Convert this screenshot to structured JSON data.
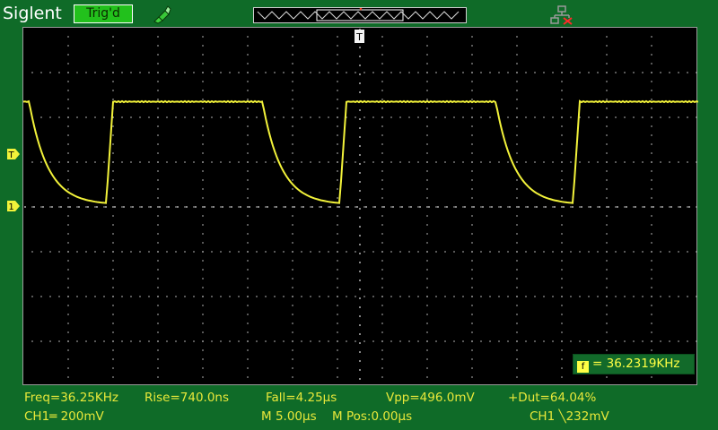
{
  "header": {
    "brand": "Siglent",
    "trigger_status": "Trig'd",
    "probe_icon": "probe-icon",
    "network_icon": "network-disconnected-icon"
  },
  "waveform": {
    "channel": "CH1",
    "color": "#f2f23a",
    "period_divisions": 5.2,
    "high_level_divisions": 2.35,
    "low_level_divisions": 0.05
  },
  "markers": {
    "trigger_level": "T",
    "channel_1": "1",
    "trigger_position": "T"
  },
  "measurements": {
    "freq": "Freq=36.25KHz",
    "rise": "Rise=740.0ns",
    "fall": "Fall=4.25µs",
    "vpp": "Vpp=496.0mV",
    "duty": "+Dut=64.04%"
  },
  "status": {
    "ch1_scale": "CH1═ 200mV",
    "timebase": "M 5.00µs",
    "mpos": "M Pos:0.00µs",
    "trigger": "CH1 ╲232mV"
  },
  "counter": {
    "icon_label": "f",
    "value": "= 36.2319KHz"
  }
}
